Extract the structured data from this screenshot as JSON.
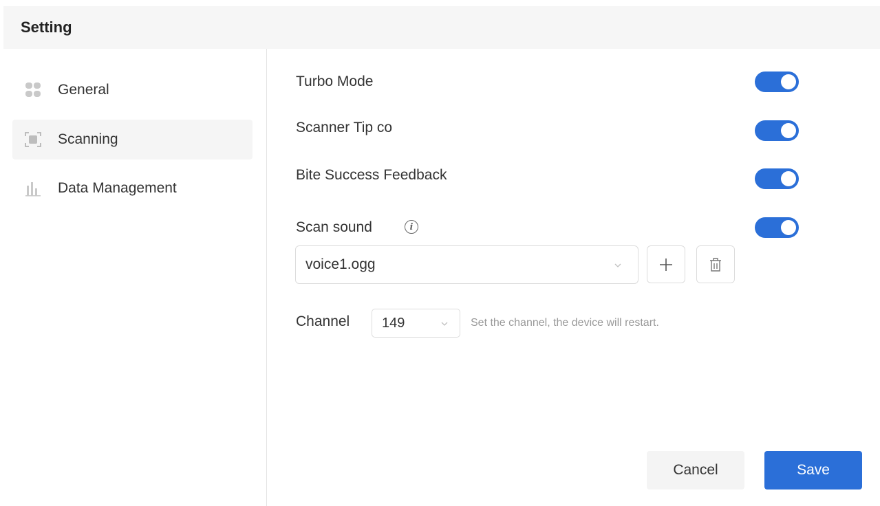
{
  "header": {
    "title": "Setting"
  },
  "sidebar": {
    "items": [
      {
        "label": "General",
        "icon": "grid-icon"
      },
      {
        "label": "Scanning",
        "icon": "scan-icon",
        "active": true
      },
      {
        "label": "Data Management",
        "icon": "bar-chart-icon"
      }
    ]
  },
  "settings": {
    "turbo_mode": {
      "label": "Turbo Mode",
      "enabled": true
    },
    "scanner_tip": {
      "label": "Scanner Tip co",
      "enabled": true
    },
    "bite_feedback": {
      "label": "Bite Success Feedback",
      "enabled": true
    },
    "scan_sound": {
      "label": "Scan sound",
      "enabled": true,
      "selected": "voice1.ogg"
    }
  },
  "channel": {
    "label": "Channel",
    "value": "149",
    "hint": "Set the channel, the device will restart."
  },
  "actions": {
    "cancel": "Cancel",
    "save": "Save"
  },
  "colors": {
    "accent": "#2b6fd8",
    "header_bg": "#f6f6f6",
    "active_item_bg": "#f5f5f5"
  }
}
